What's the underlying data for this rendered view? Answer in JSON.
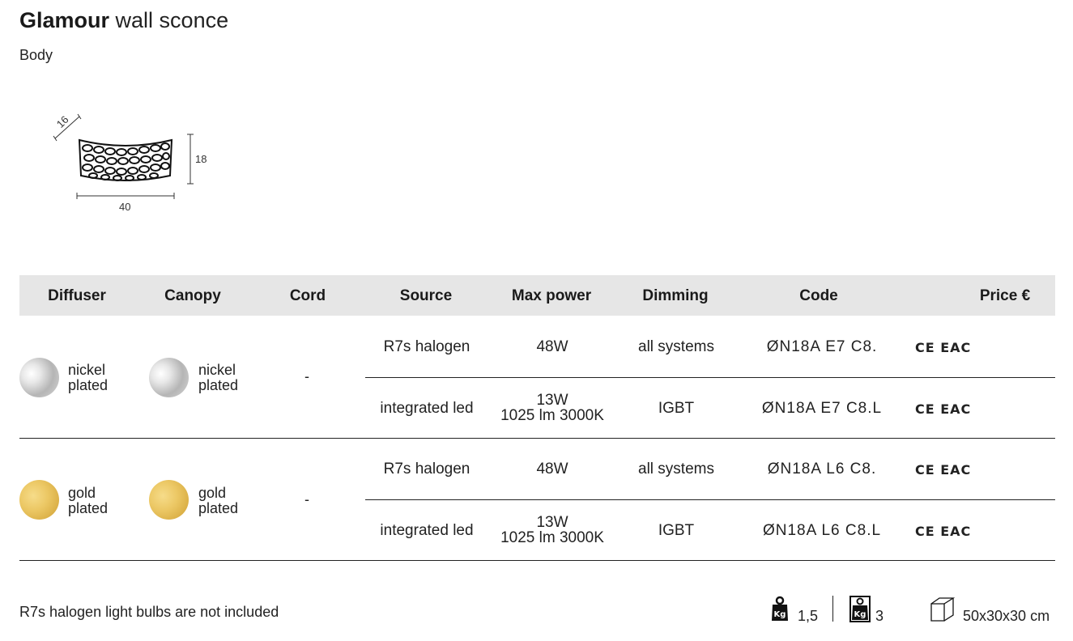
{
  "product": {
    "name": "Glamour",
    "type": "wall sconce",
    "part": "Body"
  },
  "dimensions": {
    "depth": "16",
    "height": "18",
    "width": "40"
  },
  "table": {
    "headers": [
      "Diffuser",
      "Canopy",
      "Cord",
      "Source",
      "Max power",
      "Dimming",
      "Code",
      "Price €"
    ],
    "groups": [
      {
        "diffuser": {
          "finish": "nickel plated",
          "line1": "nickel",
          "line2": "plated",
          "color": "#c8c8c8"
        },
        "canopy": {
          "line1": "nickel",
          "line2": "plated"
        },
        "cord": "-",
        "rows": [
          {
            "source": "R7s halogen",
            "power_line1": "48W",
            "power_line2": "",
            "dimming": "all systems",
            "code": "ØN18A E7 C8.",
            "marks": "CE EAC"
          },
          {
            "source": "integrated led",
            "power_line1": "13W",
            "power_line2": "1025 lm 3000K",
            "dimming": "IGBT",
            "code": "ØN18A E7 C8.L",
            "marks": "CE EAC"
          }
        ]
      },
      {
        "diffuser": {
          "finish": "gold plated",
          "line1": "gold",
          "line2": "plated",
          "color": "#e6bf58"
        },
        "canopy": {
          "line1": "gold",
          "line2": "plated"
        },
        "cord": "-",
        "rows": [
          {
            "source": "R7s halogen",
            "power_line1": "48W",
            "power_line2": "",
            "dimming": "all systems",
            "code": "ØN18A L6 C8.",
            "marks": "CE EAC"
          },
          {
            "source": "integrated led",
            "power_line1": "13W",
            "power_line2": "1025 lm 3000K",
            "dimming": "IGBT",
            "code": "ØN18A L6 C8.L",
            "marks": "CE EAC"
          }
        ]
      }
    ]
  },
  "footer": {
    "note": "R7s halogen light bulbs are not included",
    "net_weight": "1,5",
    "gross_weight": "3",
    "package": "50x30x30 cm",
    "weight_icon": "kg-weight-icon",
    "package_icon": "box-icon"
  }
}
